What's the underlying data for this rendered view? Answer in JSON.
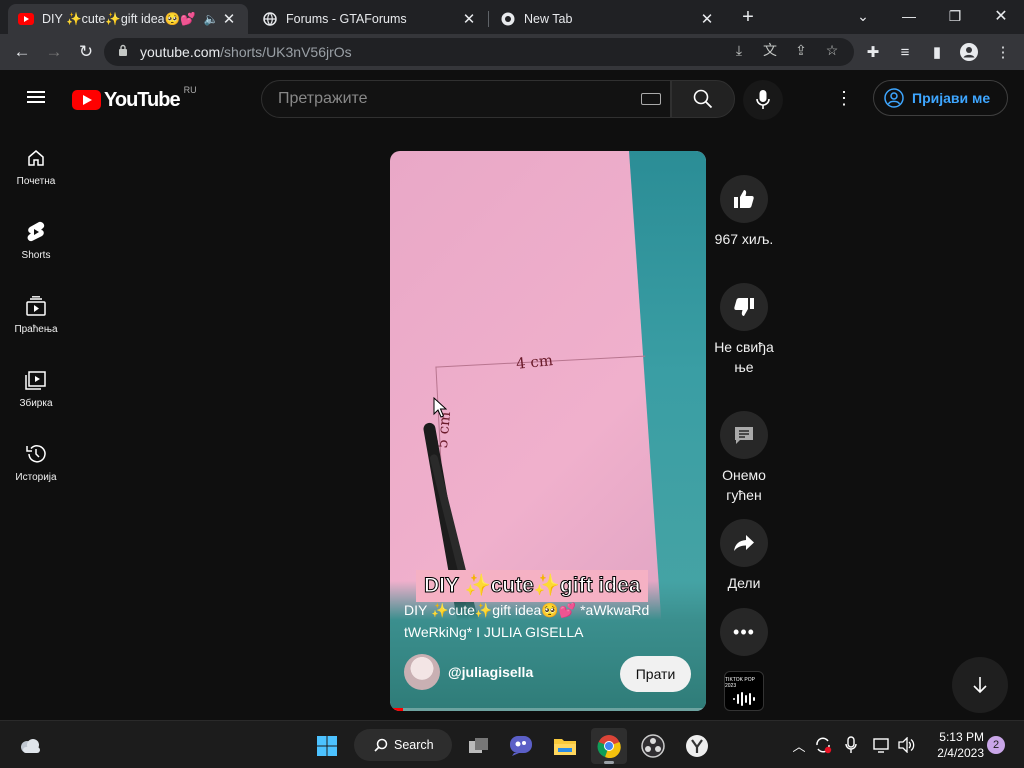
{
  "browser": {
    "tabs": [
      {
        "title": "DIY ✨cute✨gift idea🥺💕",
        "active": true
      },
      {
        "title": "Forums - GTAForums",
        "active": false
      },
      {
        "title": "New Tab",
        "active": false
      }
    ],
    "address": {
      "host": "youtube.com",
      "path": "/shorts/UK3nV56jrOs"
    }
  },
  "youtube": {
    "logo_text": "YouTube",
    "country_code": "RU",
    "search_placeholder": "Претражите",
    "signin_label": "Пријави ме",
    "guide": [
      {
        "label": "Почетна",
        "icon": "home-icon"
      },
      {
        "label": "Shorts",
        "icon": "shorts-icon"
      },
      {
        "label": "Праћења",
        "icon": "subscriptions-icon"
      },
      {
        "label": "Збирка",
        "icon": "library-icon"
      },
      {
        "label": "Историја",
        "icon": "history-icon"
      }
    ]
  },
  "short": {
    "overlay_text": "DIY ✨cute✨gift idea",
    "video_labels": {
      "width": "4 cm",
      "height": "5 cm"
    },
    "title": "DIY ✨cute✨gift idea🥺💕 *aWkwaRd tWeRkiNg* I JULIA GISELLA",
    "channel": "@juliagisella",
    "subscribe_label": "Прати",
    "progress_fraction": 0.04
  },
  "actions": {
    "like_count": "967 хиљ.",
    "dislike_label": "Не свиђа ње",
    "comments_label": "Онемо гућен",
    "share_label": "Дели",
    "sound_tile_text": "TIKTOK POP 2023"
  },
  "taskbar": {
    "search_label": "Search",
    "time": "5:13 PM",
    "date": "2/4/2023",
    "notification_count": "2"
  }
}
